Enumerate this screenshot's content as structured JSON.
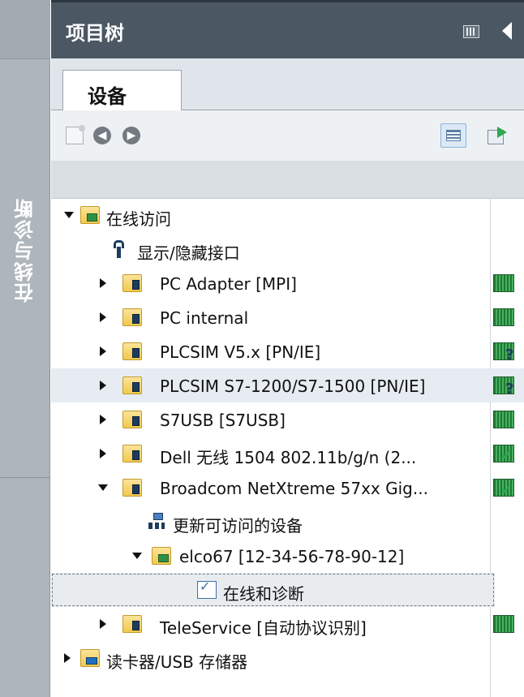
{
  "sidebar": {
    "vertical_label": "在线与诊断"
  },
  "panel": {
    "title": "项目树"
  },
  "tabs": [
    {
      "label": "设备"
    }
  ],
  "tree": {
    "rows": [
      {
        "label": "在线访问"
      },
      {
        "label": "显示/隐藏接口"
      },
      {
        "label": "PC Adapter [MPI]"
      },
      {
        "label": "PC internal"
      },
      {
        "label": "PLCSIM V5.x [PN/IE]"
      },
      {
        "label": "PLCSIM S7-1200/S7-1500 [PN/IE]"
      },
      {
        "label": "S7USB [S7USB]"
      },
      {
        "label": "Dell 无线 1504 802.11b/g/n (2..."
      },
      {
        "label": "Broadcom NetXtreme 57xx Gig..."
      },
      {
        "label": "更新可访问的设备"
      },
      {
        "label": "elco67 [12-34-56-78-90-12]"
      },
      {
        "label": "在线和诊断"
      },
      {
        "label": "TeleService [自动协议识别]"
      },
      {
        "label": "读卡器/USB 存储器"
      }
    ]
  },
  "icons": {
    "new_group": "new-group-icon",
    "back": "back-arrow-icon",
    "forward": "forward-arrow-icon",
    "details_view": "details-view-icon",
    "export": "export-icon",
    "pin": "pin-panel-icon",
    "collapse": "collapse-left-icon"
  },
  "colors": {
    "title_bar": "#4b5763",
    "sidebar": "#aeb6bc",
    "selected_row": "#e6ecf1",
    "status_green": "#48b060"
  }
}
